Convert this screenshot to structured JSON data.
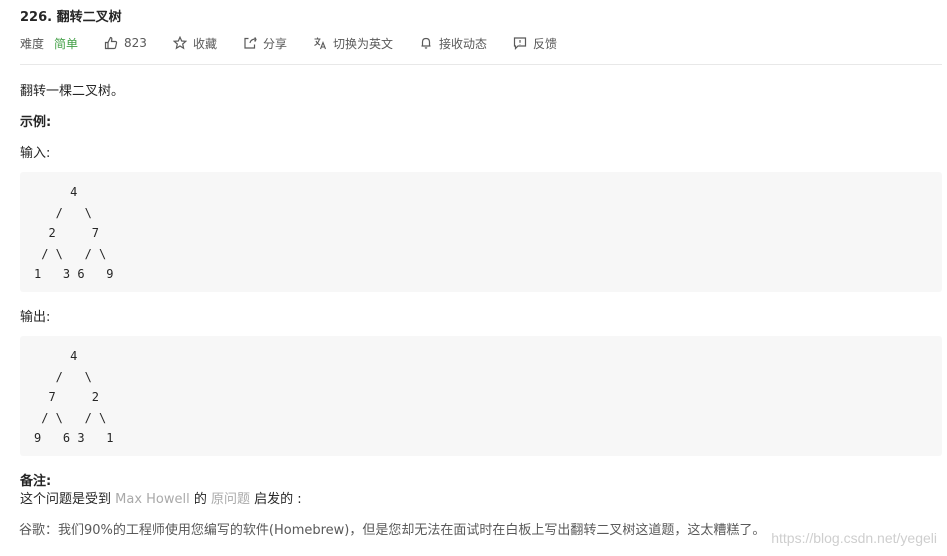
{
  "problem": {
    "title": "226. 翻转二叉树",
    "difficulty_label": "难度",
    "difficulty_value": "简单",
    "likes": "823",
    "favorite_label": "收藏",
    "share_label": "分享",
    "switch_lang_label": "切换为英文",
    "subscribe_label": "接收动态",
    "feedback_label": "反馈"
  },
  "content": {
    "description": "翻转一棵二叉树。",
    "example_heading": "示例:",
    "input_label": "输入:",
    "input_tree": "     4\n   /   \\\n  2     7\n / \\   / \\\n1   3 6   9",
    "output_label": "输出:",
    "output_tree": "     4\n   /   \\\n  7     2\n / \\   / \\\n9   6 3   1",
    "note_heading": "备注:",
    "note_prefix": "这个问题是受到 ",
    "note_link_author": "Max Howell",
    "note_middle": " 的 ",
    "note_link_original": "原问题",
    "note_suffix": " 启发的 :",
    "quote": "谷歌：我们90%的工程师使用您编写的软件(Homebrew)，但是您却无法在面试时在白板上写出翻转二叉树这道题，这太糟糕了。"
  },
  "watermark": "https://blog.csdn.net/yegeli",
  "colors": {
    "easy": "#43a047",
    "link": "#a9a9a9",
    "code_bg": "#f7f7f7"
  }
}
